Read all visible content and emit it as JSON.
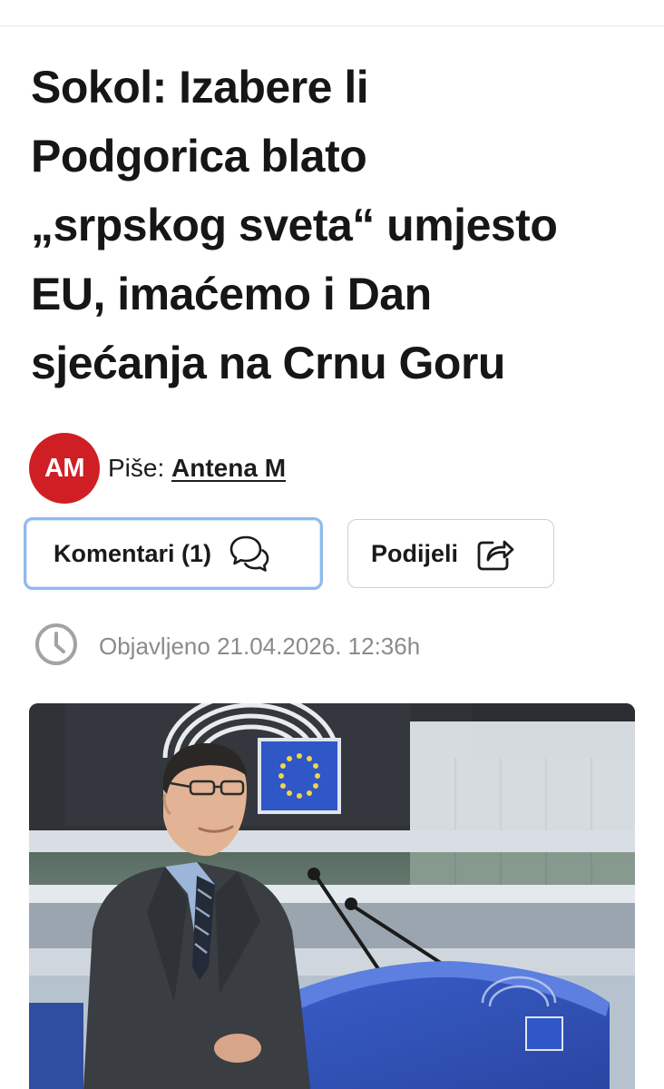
{
  "article": {
    "headline_lines": [
      "Sokol: Izabere li",
      "Podgorica blato",
      "„srpskog sveta“ umjesto",
      "EU, imaćemo i Dan",
      "sjećanja na Crnu Goru"
    ],
    "author": {
      "avatar_initials": "AM",
      "avatar_color": "#cf1f25",
      "prefix": "Piše:",
      "name": "Antena M"
    },
    "comments_button": {
      "label": "Komentari (1)",
      "icon": "chat-bubbles-icon",
      "border_color": "#8fb9f0"
    },
    "share_button": {
      "label": "Podijeli",
      "icon": "share-arrow-icon"
    },
    "published": {
      "icon": "clock-icon",
      "text": "Objavljeno 21.04.2026. 12:36h"
    },
    "image": {
      "icon": "article-photo",
      "eu_blue": "#2f57c8"
    }
  }
}
